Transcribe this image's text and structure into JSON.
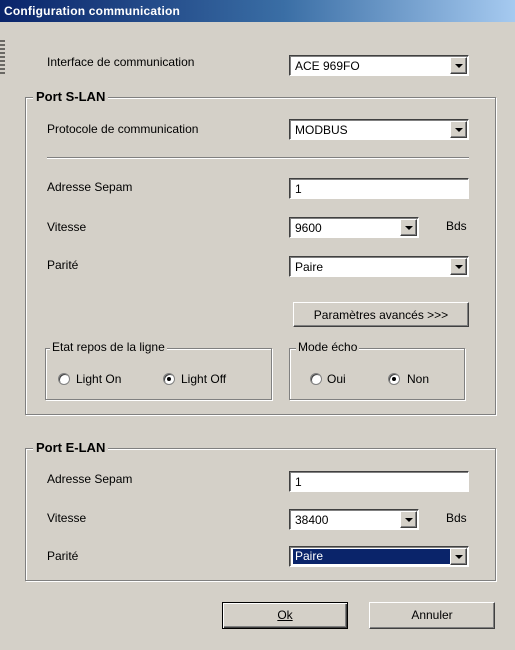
{
  "window": {
    "title": "Configuration communication"
  },
  "interface": {
    "label": "Interface de communication",
    "value": "ACE 969FO"
  },
  "slan": {
    "title": "Port S-LAN",
    "protocol_label": "Protocole de communication",
    "protocol_value": "MODBUS",
    "address_label": "Adresse Sepam",
    "address_value": "1",
    "speed_label": "Vitesse",
    "speed_value": "9600",
    "speed_unit": "Bds",
    "parity_label": "Parité",
    "parity_value": "Paire",
    "advanced_button": "Paramètres avancés >>>",
    "idle_state": {
      "title": "Etat repos de la ligne",
      "option_on": "Light On",
      "option_off": "Light Off",
      "selected": "Light Off"
    },
    "echo_mode": {
      "title": "Mode écho",
      "option_yes": "Oui",
      "option_no": "Non",
      "selected": "Non"
    }
  },
  "elan": {
    "title": "Port E-LAN",
    "address_label": "Adresse Sepam",
    "address_value": "1",
    "speed_label": "Vitesse",
    "speed_value": "38400",
    "speed_unit": "Bds",
    "parity_label": "Parité",
    "parity_value": "Paire"
  },
  "buttons": {
    "ok": "Ok",
    "cancel": "Annuler"
  }
}
